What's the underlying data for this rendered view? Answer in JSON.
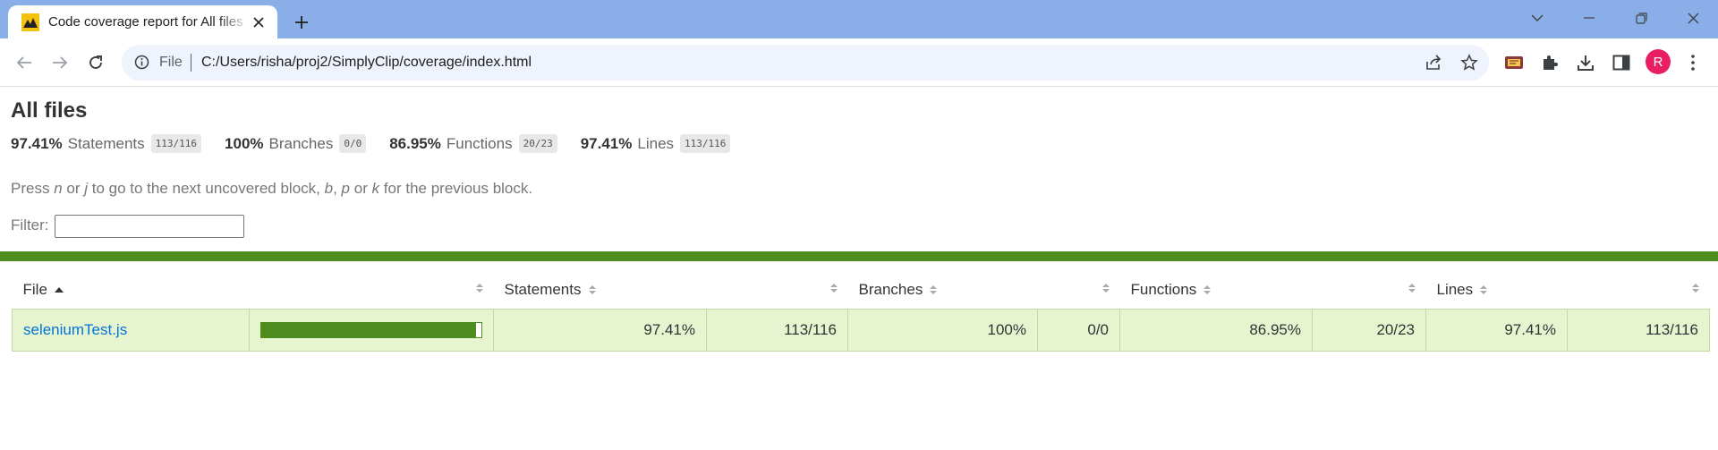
{
  "browser": {
    "tab_title": "Code coverage report for All files",
    "scheme_label": "File",
    "url": "C:/Users/risha/proj2/SimplyClip/coverage/index.html",
    "avatar_letter": "R"
  },
  "report": {
    "title": "All files",
    "summary": [
      {
        "pct": "97.41%",
        "label": "Statements",
        "fraction": "113/116"
      },
      {
        "pct": "100%",
        "label": "Branches",
        "fraction": "0/0"
      },
      {
        "pct": "86.95%",
        "label": "Functions",
        "fraction": "20/23"
      },
      {
        "pct": "97.41%",
        "label": "Lines",
        "fraction": "113/116"
      }
    ],
    "hint": {
      "press": "Press ",
      "n": "n",
      "or1": " or ",
      "j": "j",
      "mid": " to go to the next uncovered block, ",
      "b": "b",
      "comma": ", ",
      "p": "p",
      "or2": " or ",
      "k": "k",
      "end": " for the previous block."
    },
    "filter_label": "Filter:",
    "filter_value": "",
    "columns": {
      "file": "File",
      "statements": "Statements",
      "branches": "Branches",
      "functions": "Functions",
      "lines": "Lines"
    },
    "rows": [
      {
        "file": "seleniumTest.js",
        "coverage_fraction": 0.9741,
        "statements_pct": "97.41%",
        "statements_frac": "113/116",
        "branches_pct": "100%",
        "branches_frac": "0/0",
        "functions_pct": "86.95%",
        "functions_frac": "20/23",
        "lines_pct": "97.41%",
        "lines_frac": "113/116"
      }
    ]
  },
  "colors": {
    "coverage_high": "#4d8c1f",
    "row_bg": "#e6f5d0",
    "tabbar": "#8aaee8",
    "link": "#0074d9"
  }
}
